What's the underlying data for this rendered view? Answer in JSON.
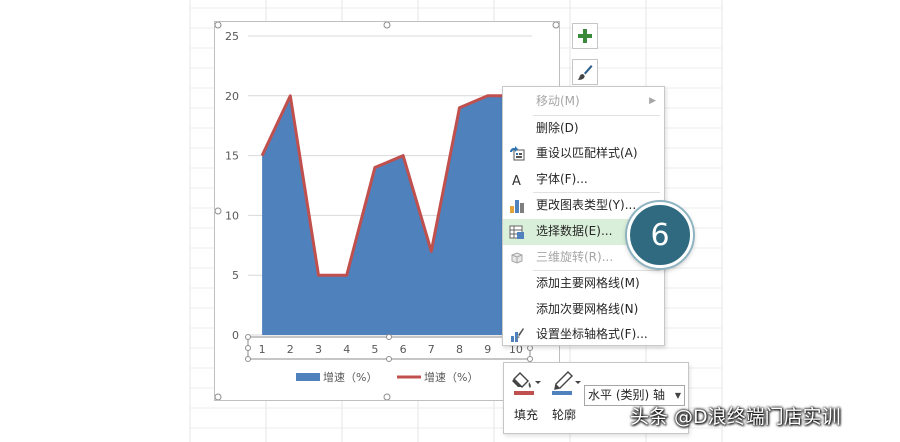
{
  "chart_data": {
    "type": "area",
    "x": [
      "1",
      "2",
      "3",
      "4",
      "5",
      "6",
      "7",
      "8",
      "9",
      "10"
    ],
    "series": [
      {
        "name": "增速（%）",
        "type": "area",
        "color": "#4f81bd",
        "values": [
          15,
          20,
          5,
          5,
          14,
          15,
          7,
          19,
          20,
          20
        ]
      },
      {
        "name": "增速（%）",
        "type": "line",
        "color": "#c0504d",
        "values": [
          15,
          20,
          5,
          5,
          14,
          15,
          7,
          19,
          20,
          20
        ]
      }
    ],
    "y_ticks": [
      "0",
      "5",
      "10",
      "15",
      "20",
      "25"
    ],
    "ylim": [
      0,
      25
    ],
    "grid": true,
    "legend_position": "bottom"
  },
  "context_menu": {
    "items": [
      {
        "label": "移动(M)",
        "icon": "none",
        "disabled": true,
        "submenu": true
      },
      {
        "label": "删除(D)",
        "icon": "none"
      },
      {
        "label": "重设以匹配样式(A)",
        "icon": "reset-style-icon"
      },
      {
        "label": "字体(F)...",
        "icon": "font-icon"
      },
      {
        "label": "更改图表类型(Y)...",
        "icon": "chart-type-icon"
      },
      {
        "label": "选择数据(E)...",
        "icon": "select-data-icon",
        "highlight": true
      },
      {
        "label": "三维旋转(R)...",
        "icon": "3d-rotate-icon",
        "disabled": true
      },
      {
        "label": "添加主要网格线(M)",
        "icon": "none"
      },
      {
        "label": "添加次要网格线(N)",
        "icon": "none"
      },
      {
        "label": "设置坐标轴格式(F)...",
        "icon": "axis-format-icon"
      }
    ]
  },
  "step_badge": "6",
  "toolbar": {
    "fill_label": "填充",
    "outline_label": "轮廓",
    "element_select_value": "水平 (类别) 轴",
    "fill_color": "#c0504d",
    "outline_color": "#4f81bd"
  },
  "watermark": "头条 @D浪终端门店实训"
}
